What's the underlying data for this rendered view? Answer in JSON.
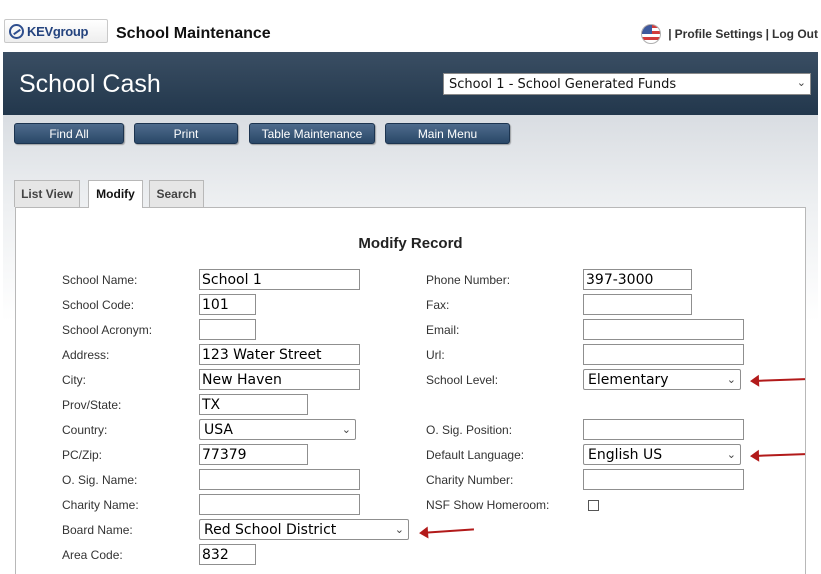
{
  "header": {
    "logo_text": "KEVgroup",
    "app_title": "School Maintenance",
    "links": [
      "Profile Settings",
      "Log Out"
    ],
    "separator": "|"
  },
  "banner": {
    "title": "School Cash",
    "fund_select": "School 1 - School Generated Funds"
  },
  "toolbar": {
    "buttons": [
      "Find All",
      "Print",
      "Table Maintenance",
      "Main Menu"
    ]
  },
  "tabs": [
    "List View",
    "Modify",
    "Search"
  ],
  "active_tab": "Modify",
  "form": {
    "title": "Modify Record",
    "left": [
      {
        "label": "School Name:",
        "value": "School 1"
      },
      {
        "label": "School Code:",
        "value": "101"
      },
      {
        "label": "School Acronym:",
        "value": ""
      },
      {
        "label": "Address:",
        "value": "123 Water Street"
      },
      {
        "label": "City:",
        "value": "New Haven"
      },
      {
        "label": "Prov/State:",
        "value": "TX"
      },
      {
        "label": "Country:",
        "value": "USA"
      },
      {
        "label": "PC/Zip:",
        "value": "77379"
      },
      {
        "label": "O. Sig. Name:",
        "value": ""
      },
      {
        "label": "Charity Name:",
        "value": ""
      },
      {
        "label": "Board Name:",
        "value": "Red School District"
      },
      {
        "label": "Area Code:",
        "value": "832"
      }
    ],
    "right": [
      {
        "label": "Phone Number:",
        "value": "397-3000"
      },
      {
        "label": "Fax:",
        "value": ""
      },
      {
        "label": "Email:",
        "value": ""
      },
      {
        "label": "Url:",
        "value": ""
      },
      {
        "label": "School Level:",
        "value": "Elementary"
      },
      {
        "label": "O. Sig. Position:",
        "value": ""
      },
      {
        "label": "Default Language:",
        "value": "English US"
      },
      {
        "label": "Charity Number:",
        "value": ""
      },
      {
        "label": "NSF Show Homeroom:",
        "checked": false
      }
    ]
  },
  "colors": {
    "banner": "#2a3e53",
    "button": "#3b5878",
    "annotation_arrow": "#b21a1a"
  },
  "icons": {
    "flag": "us-flag-icon",
    "logo": "kevgroup-logo-icon",
    "dropdown": "chevron-down-icon"
  }
}
